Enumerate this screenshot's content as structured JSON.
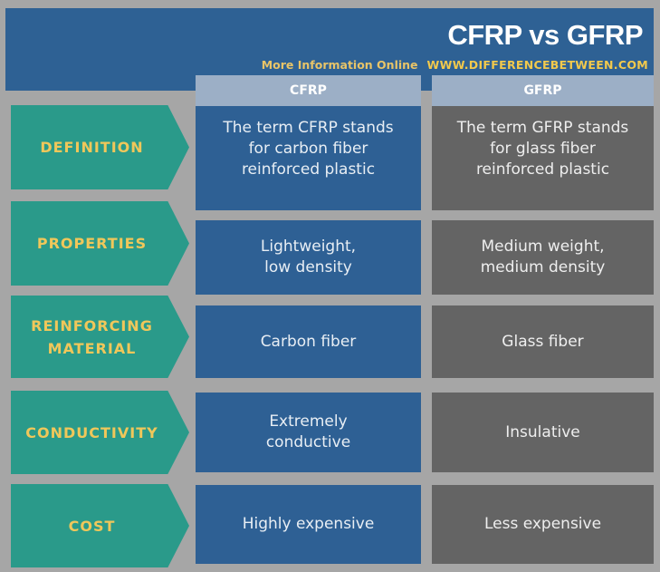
{
  "header": {
    "title": "CFRP vs GFRP",
    "more_info": "More Information  Online",
    "url": "WWW.DIFFERENCEBETWEEN.COM"
  },
  "columns": [
    "CFRP",
    "GFRP"
  ],
  "rows": [
    {
      "label": "DEFINITION",
      "cfrp": "The term CFRP stands\nfor carbon fiber\nreinforced plastic",
      "gfrp": "The term GFRP stands\nfor glass fiber\nreinforced plastic"
    },
    {
      "label": "PROPERTIES",
      "cfrp": "Lightweight,\nlow density",
      "gfrp": "Medium weight,\nmedium density"
    },
    {
      "label": "REINFORCING\nMATERIAL",
      "cfrp": "Carbon fiber",
      "gfrp": "Glass fiber"
    },
    {
      "label": "CONDUCTIVITY",
      "cfrp": "Extremely\nconductive",
      "gfrp": "Insulative"
    },
    {
      "label": "COST",
      "cfrp": "Highly expensive",
      "gfrp": "Less expensive"
    }
  ],
  "colors": {
    "banner": "#2e6194",
    "label_bg": "#2a9a8a",
    "label_text": "#f0c75a",
    "cfrp_bg": "#2e6094",
    "gfrp_bg": "#646464",
    "column_header_bg": "#9cafc6",
    "background": "#a6a6a6"
  }
}
